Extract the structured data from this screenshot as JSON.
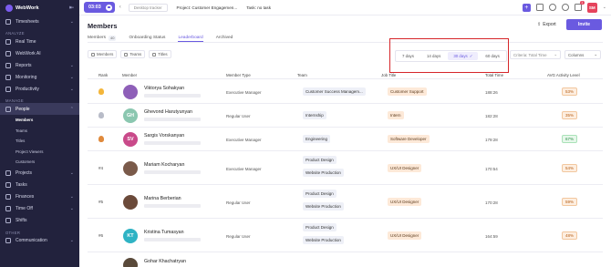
{
  "app": {
    "brand": "WebWork"
  },
  "sidebar": {
    "timesheets": "Timesheets",
    "analyze_label": "ANALYZE",
    "analyze": [
      "Real Time",
      "WebWork AI",
      "Reports",
      "Monitoring",
      "Productivity"
    ],
    "manage_label": "MANAGE",
    "people": "People",
    "people_sub": [
      "Members",
      "Teams",
      "Titles",
      "Project Viewers",
      "Customers"
    ],
    "manage": [
      "Projects",
      "Tasks",
      "Finances",
      "Time Off",
      "Shifts"
    ],
    "other_label": "OTHER",
    "communication": "Communication"
  },
  "topbar": {
    "timer": "03:03",
    "tracker": "Desktop tracker",
    "project": "Project: Customer Engagemen...",
    "task": "Task: no task",
    "notif_count": "1",
    "user_initials": "SM",
    "accent": "#6a5ae0"
  },
  "page": {
    "title": "Members",
    "export": "Export",
    "invite": "Invite",
    "tabs": [
      {
        "label": "Members",
        "count": "40"
      },
      {
        "label": "Onboarding Status"
      },
      {
        "label": "Leaderboard"
      },
      {
        "label": "Archived"
      }
    ],
    "filters": [
      "Members",
      "Teams",
      "Titles"
    ],
    "days": [
      "7 days",
      "14 days",
      "30 days",
      "60 days"
    ],
    "criteria": "Criteria: Total Time",
    "columns": "Columns"
  },
  "table": {
    "headers": [
      "Rank",
      "Member",
      "Member Type",
      "Team",
      "Job Title",
      "Total Time",
      "AVG Activity Level"
    ],
    "rows": [
      {
        "rank": "",
        "name": "Viktorya Sohakyan",
        "type": "Executive Manager",
        "teams": [
          "Customer Success Managem..."
        ],
        "job": "Customer Support",
        "total": "188:26",
        "avg": "53%",
        "avg_tone": "orange"
      },
      {
        "rank": "",
        "initials": "GH",
        "name": "Ghevond Harutyunyan",
        "type": "Regular User",
        "teams": [
          "Internship"
        ],
        "job": "Intern",
        "total": "182:28",
        "avg": "35%",
        "avg_tone": "orange"
      },
      {
        "rank": "",
        "initials": "SV",
        "name": "Sargis Vorskanyan",
        "type": "Executive Manager",
        "teams": [
          "Engineering"
        ],
        "job": "Software Developer",
        "total": "179:28",
        "avg": "67%",
        "avg_tone": "green"
      },
      {
        "rank": "#4",
        "name": "Mariam Kocharyan",
        "type": "Executive Manager",
        "teams": [
          "Product Design",
          "Website Production"
        ],
        "job": "UX/UI Designer",
        "total": "170:54",
        "avg": "54%",
        "avg_tone": "orange"
      },
      {
        "rank": "#5",
        "name": "Marina Berberian",
        "type": "Regular User",
        "teams": [
          "Product Design",
          "Website Production"
        ],
        "job": "UX/UI Designer",
        "total": "170:28",
        "avg": "59%",
        "avg_tone": "orange"
      },
      {
        "rank": "#6",
        "initials": "KT",
        "name": "Kristina Tumasyan",
        "type": "Regular User",
        "teams": [
          "Product Design",
          "Website Production"
        ],
        "job": "UX/UI Designer",
        "total": "164:59",
        "avg": "48%",
        "avg_tone": "orange"
      },
      {
        "rank": "",
        "name": "Gohar Khachatryan",
        "type": "",
        "teams": [],
        "job": "",
        "total": "",
        "avg": "",
        "avg_tone": ""
      }
    ]
  }
}
